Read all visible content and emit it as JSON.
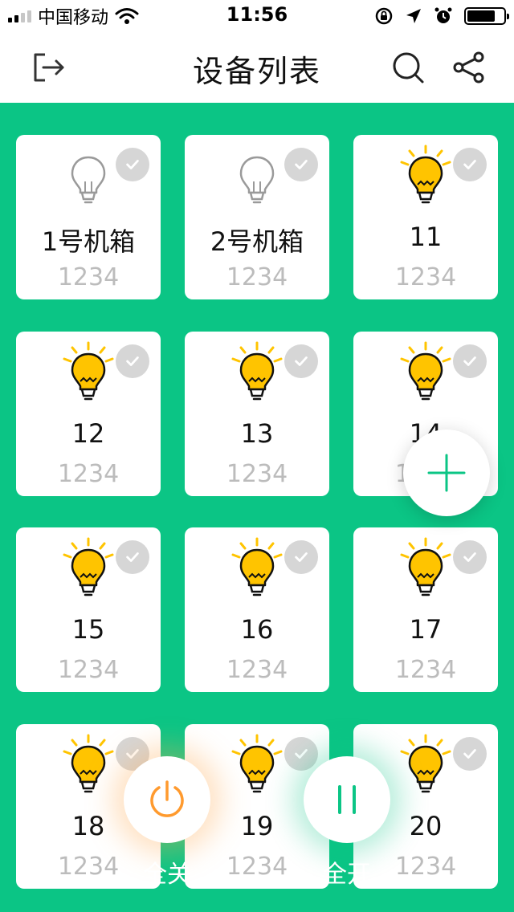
{
  "status_bar": {
    "carrier": "中国移动",
    "time": "11:56",
    "icons": [
      "signal-icon",
      "wifi-icon",
      "rotation-lock-icon",
      "location-arrow-icon",
      "alarm-icon",
      "battery-icon"
    ]
  },
  "header": {
    "title": "设备列表",
    "left_icon": "logout-icon",
    "right_icons": [
      "search-icon",
      "share-icon"
    ]
  },
  "colors": {
    "background": "#0bc585",
    "bulb_on": "#ffc400",
    "bulb_off_outline": "#9a9a9a",
    "check_bg": "#d6d6d6",
    "code_text": "#bcbcbc",
    "off_button_accent": "#ff9a2e",
    "on_button_accent": "#0bc585"
  },
  "devices": [
    {
      "name": "1号机箱",
      "code": "1234",
      "on": false
    },
    {
      "name": "2号机箱",
      "code": "1234",
      "on": false
    },
    {
      "name": "11",
      "code": "1234",
      "on": true
    },
    {
      "name": "12",
      "code": "1234",
      "on": true
    },
    {
      "name": "13",
      "code": "1234",
      "on": true
    },
    {
      "name": "14",
      "code": "1234",
      "on": true
    },
    {
      "name": "15",
      "code": "1234",
      "on": true
    },
    {
      "name": "16",
      "code": "1234",
      "on": true
    },
    {
      "name": "17",
      "code": "1234",
      "on": true
    },
    {
      "name": "18",
      "code": "1234",
      "on": true
    },
    {
      "name": "19",
      "code": "1234",
      "on": true
    },
    {
      "name": "20",
      "code": "1234",
      "on": true
    }
  ],
  "actions": {
    "add_icon": "plus-icon",
    "all_off_label": "全关",
    "all_off_icon": "power-icon",
    "all_on_label": "全开",
    "all_on_icon": "pause-icon"
  }
}
